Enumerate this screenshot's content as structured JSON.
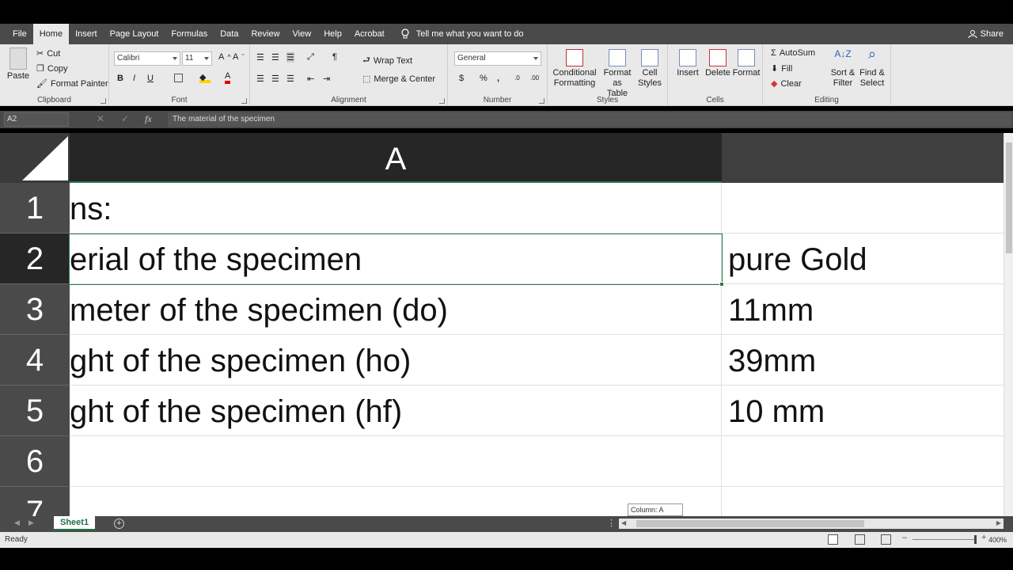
{
  "tabs": [
    "File",
    "Home",
    "Insert",
    "Page Layout",
    "Formulas",
    "Data",
    "Review",
    "View",
    "Help",
    "Acrobat"
  ],
  "tell_me": "Tell me what you want to do",
  "share": "Share",
  "clipboard": {
    "paste": "Paste",
    "cut": "Cut",
    "copy": "Copy",
    "format_painter": "Format Painter",
    "label": "Clipboard"
  },
  "font": {
    "name": "Calibri",
    "size": "11",
    "label": "Font",
    "bold": "B",
    "italic": "I",
    "underline": "U"
  },
  "alignment": {
    "wrap_text": "Wrap Text",
    "merge_center": "Merge & Center",
    "label": "Alignment"
  },
  "number": {
    "format": "General",
    "label": "Number",
    "currency": "$",
    "percent": "%",
    "comma": ","
  },
  "styles": {
    "conditional": "Conditional",
    "conditional2": "Formatting",
    "format_as": "Format as",
    "format_as2": "Table",
    "cell": "Cell",
    "cell2": "Styles",
    "label": "Styles"
  },
  "cells": {
    "insert": "Insert",
    "delete": "Delete",
    "format": "Format",
    "label": "Cells"
  },
  "editing": {
    "autosum": "AutoSum",
    "fill": "Fill",
    "clear": "Clear",
    "sort": "Sort &",
    "sort2": "Filter",
    "find": "Find &",
    "find2": "Select",
    "label": "Editing"
  },
  "formula_bar": {
    "name_box": "A2",
    "fx": "fx",
    "content": "The material of the specimen"
  },
  "grid": {
    "column_a": "A",
    "rows": [
      {
        "num": "1",
        "a": "ns:",
        "b": ""
      },
      {
        "num": "2",
        "a": "erial of the specimen",
        "b": "pure Gold"
      },
      {
        "num": "3",
        "a": "meter of the specimen (do)",
        "b": "11mm"
      },
      {
        "num": "4",
        "a": "ght of the specimen (ho)",
        "b": "39mm"
      },
      {
        "num": "5",
        "a": "ght of the specimen (hf)",
        "b": "10 mm"
      },
      {
        "num": "6",
        "a": "",
        "b": ""
      },
      {
        "num": "7",
        "a": "",
        "b": ""
      }
    ],
    "tooltip": "Column: A"
  },
  "sheet_tab": "Sheet1",
  "status": {
    "ready": "Ready",
    "zoom": "400%"
  },
  "colors": {
    "accent": "#2a7a4b",
    "ribbon_dark": "#4a4a4a"
  }
}
